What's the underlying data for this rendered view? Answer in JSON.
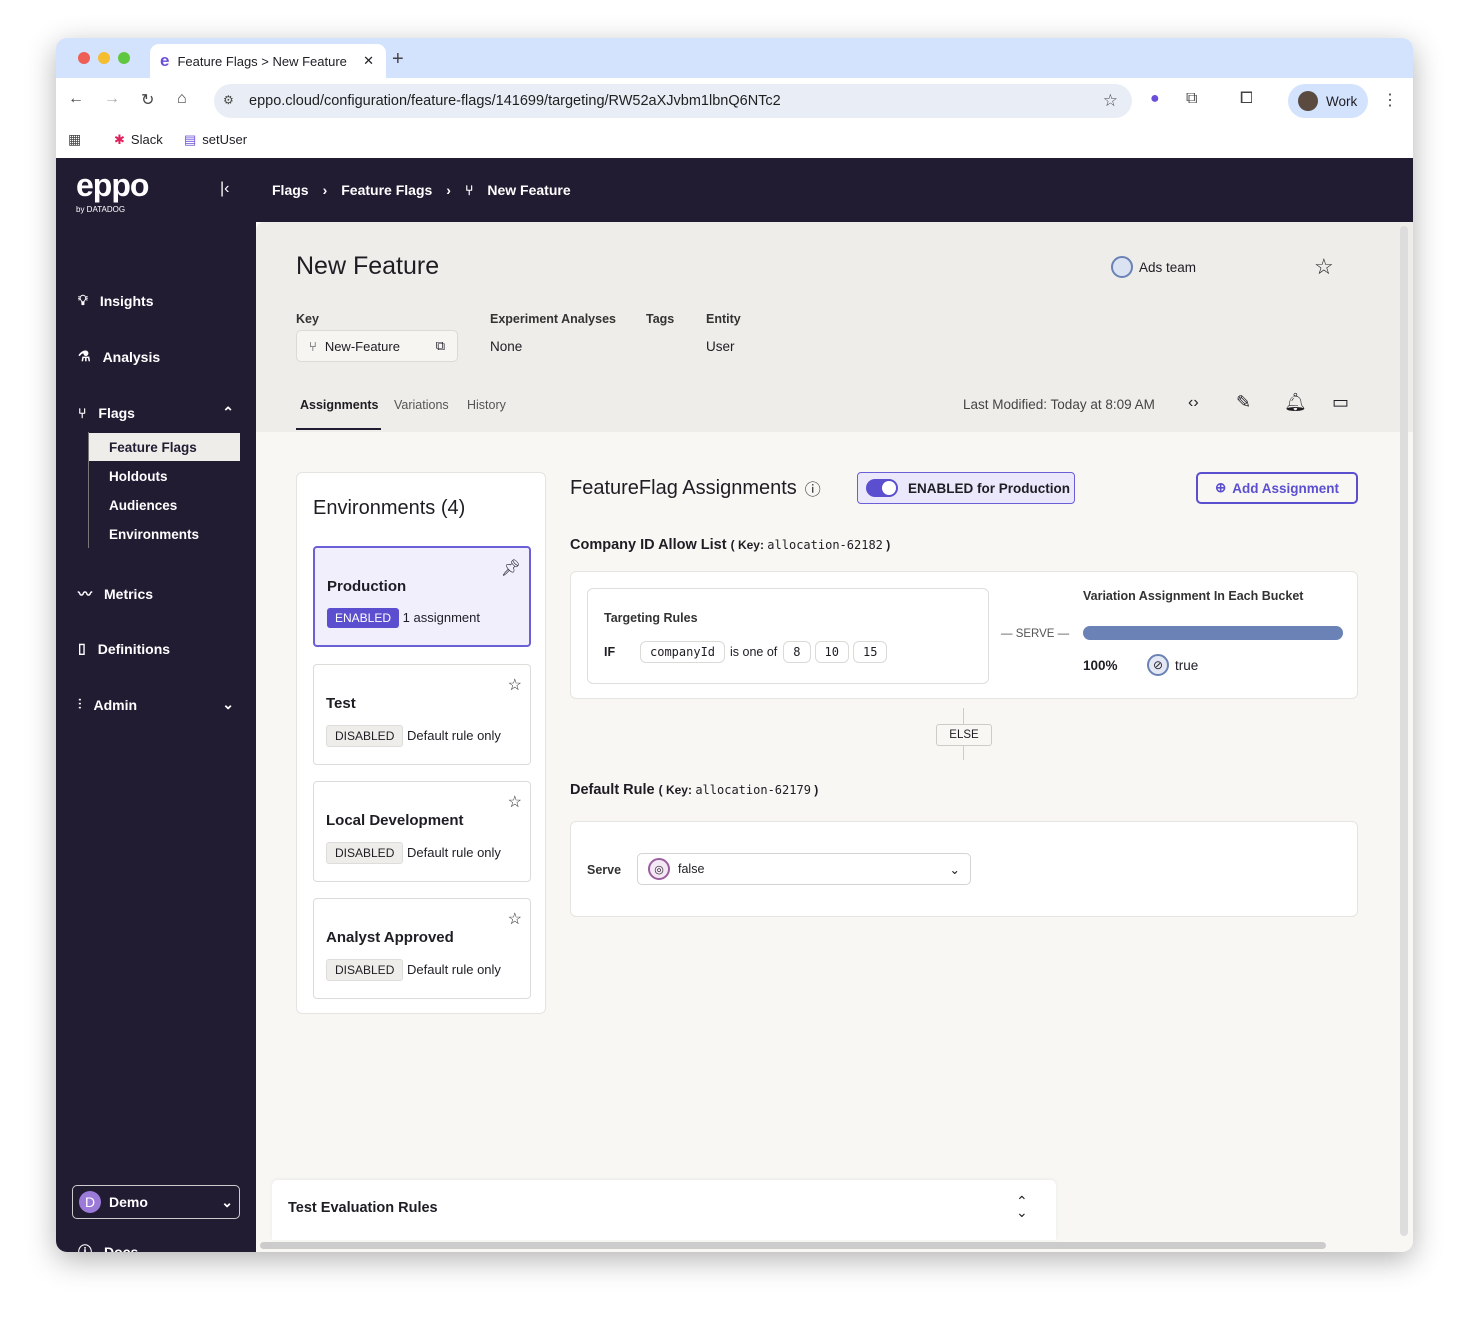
{
  "browser": {
    "tab_title": "Feature Flags > New Feature",
    "url": "eppo.cloud/configuration/feature-flags/141699/targeting/RW52aXJvbm1lbnQ6NTc2",
    "profile": "Work",
    "bookmarks": [
      "Slack",
      "setUser"
    ]
  },
  "app": {
    "logo": "eppo",
    "logo_sub": "by DATADOG",
    "breadcrumb": [
      "Flags",
      "Feature Flags",
      "New Feature"
    ]
  },
  "sidebar": {
    "items": [
      {
        "label": "Insights",
        "icon": "lightbulb-icon"
      },
      {
        "label": "Analysis",
        "icon": "flask-icon"
      },
      {
        "label": "Flags",
        "icon": "flag-branch-icon"
      },
      {
        "label": "Metrics",
        "icon": "chart-line-icon"
      },
      {
        "label": "Definitions",
        "icon": "book-icon"
      },
      {
        "label": "Admin",
        "icon": "sliders-icon"
      }
    ],
    "flags_sub": [
      "Feature Flags",
      "Holdouts",
      "Audiences",
      "Environments"
    ],
    "workspace": "Demo",
    "workspace_initial": "D",
    "docs": "Docs"
  },
  "flag": {
    "title": "New Feature",
    "team": "Ads team",
    "key_label": "Key",
    "key": "New-Feature",
    "analyses_label": "Experiment Analyses",
    "analyses": "None",
    "tags_label": "Tags",
    "entity_label": "Entity",
    "entity": "User",
    "tabs": [
      "Assignments",
      "Variations",
      "History"
    ],
    "last_modified": "Last Modified: Today at 8:09 AM"
  },
  "environments": {
    "title": "Environments (4)",
    "items": [
      {
        "name": "Production",
        "status": "ENABLED",
        "detail": "1 assignment"
      },
      {
        "name": "Test",
        "status": "DISABLED",
        "detail": "Default rule only"
      },
      {
        "name": "Local Development",
        "status": "DISABLED",
        "detail": "Default rule only"
      },
      {
        "name": "Analyst Approved",
        "status": "DISABLED",
        "detail": "Default rule only"
      }
    ]
  },
  "assignments": {
    "title": "FeatureFlag Assignments",
    "toggle": "ENABLED for Production",
    "add": "Add Assignment",
    "allocation": {
      "name": "Company ID Allow List",
      "key_label": "Key:",
      "key": "allocation-62182",
      "rules_label": "Targeting Rules",
      "if": "IF",
      "attribute": "companyId",
      "operator": "is one of",
      "values": [
        "8",
        "10",
        "15"
      ],
      "serve": "SERVE",
      "bucket_label": "Variation Assignment In Each Bucket",
      "percent": "100%",
      "percent_value": 100,
      "variation": "true"
    },
    "else": "ELSE",
    "default": {
      "name": "Default Rule",
      "key_label": "Key:",
      "key": "allocation-62179",
      "serve_label": "Serve",
      "value": "false"
    }
  },
  "footer": {
    "test_rules": "Test Evaluation Rules"
  },
  "colors": {
    "accent": "#5b4fcf",
    "dark": "#221c33",
    "bar": "#6a82b5"
  }
}
